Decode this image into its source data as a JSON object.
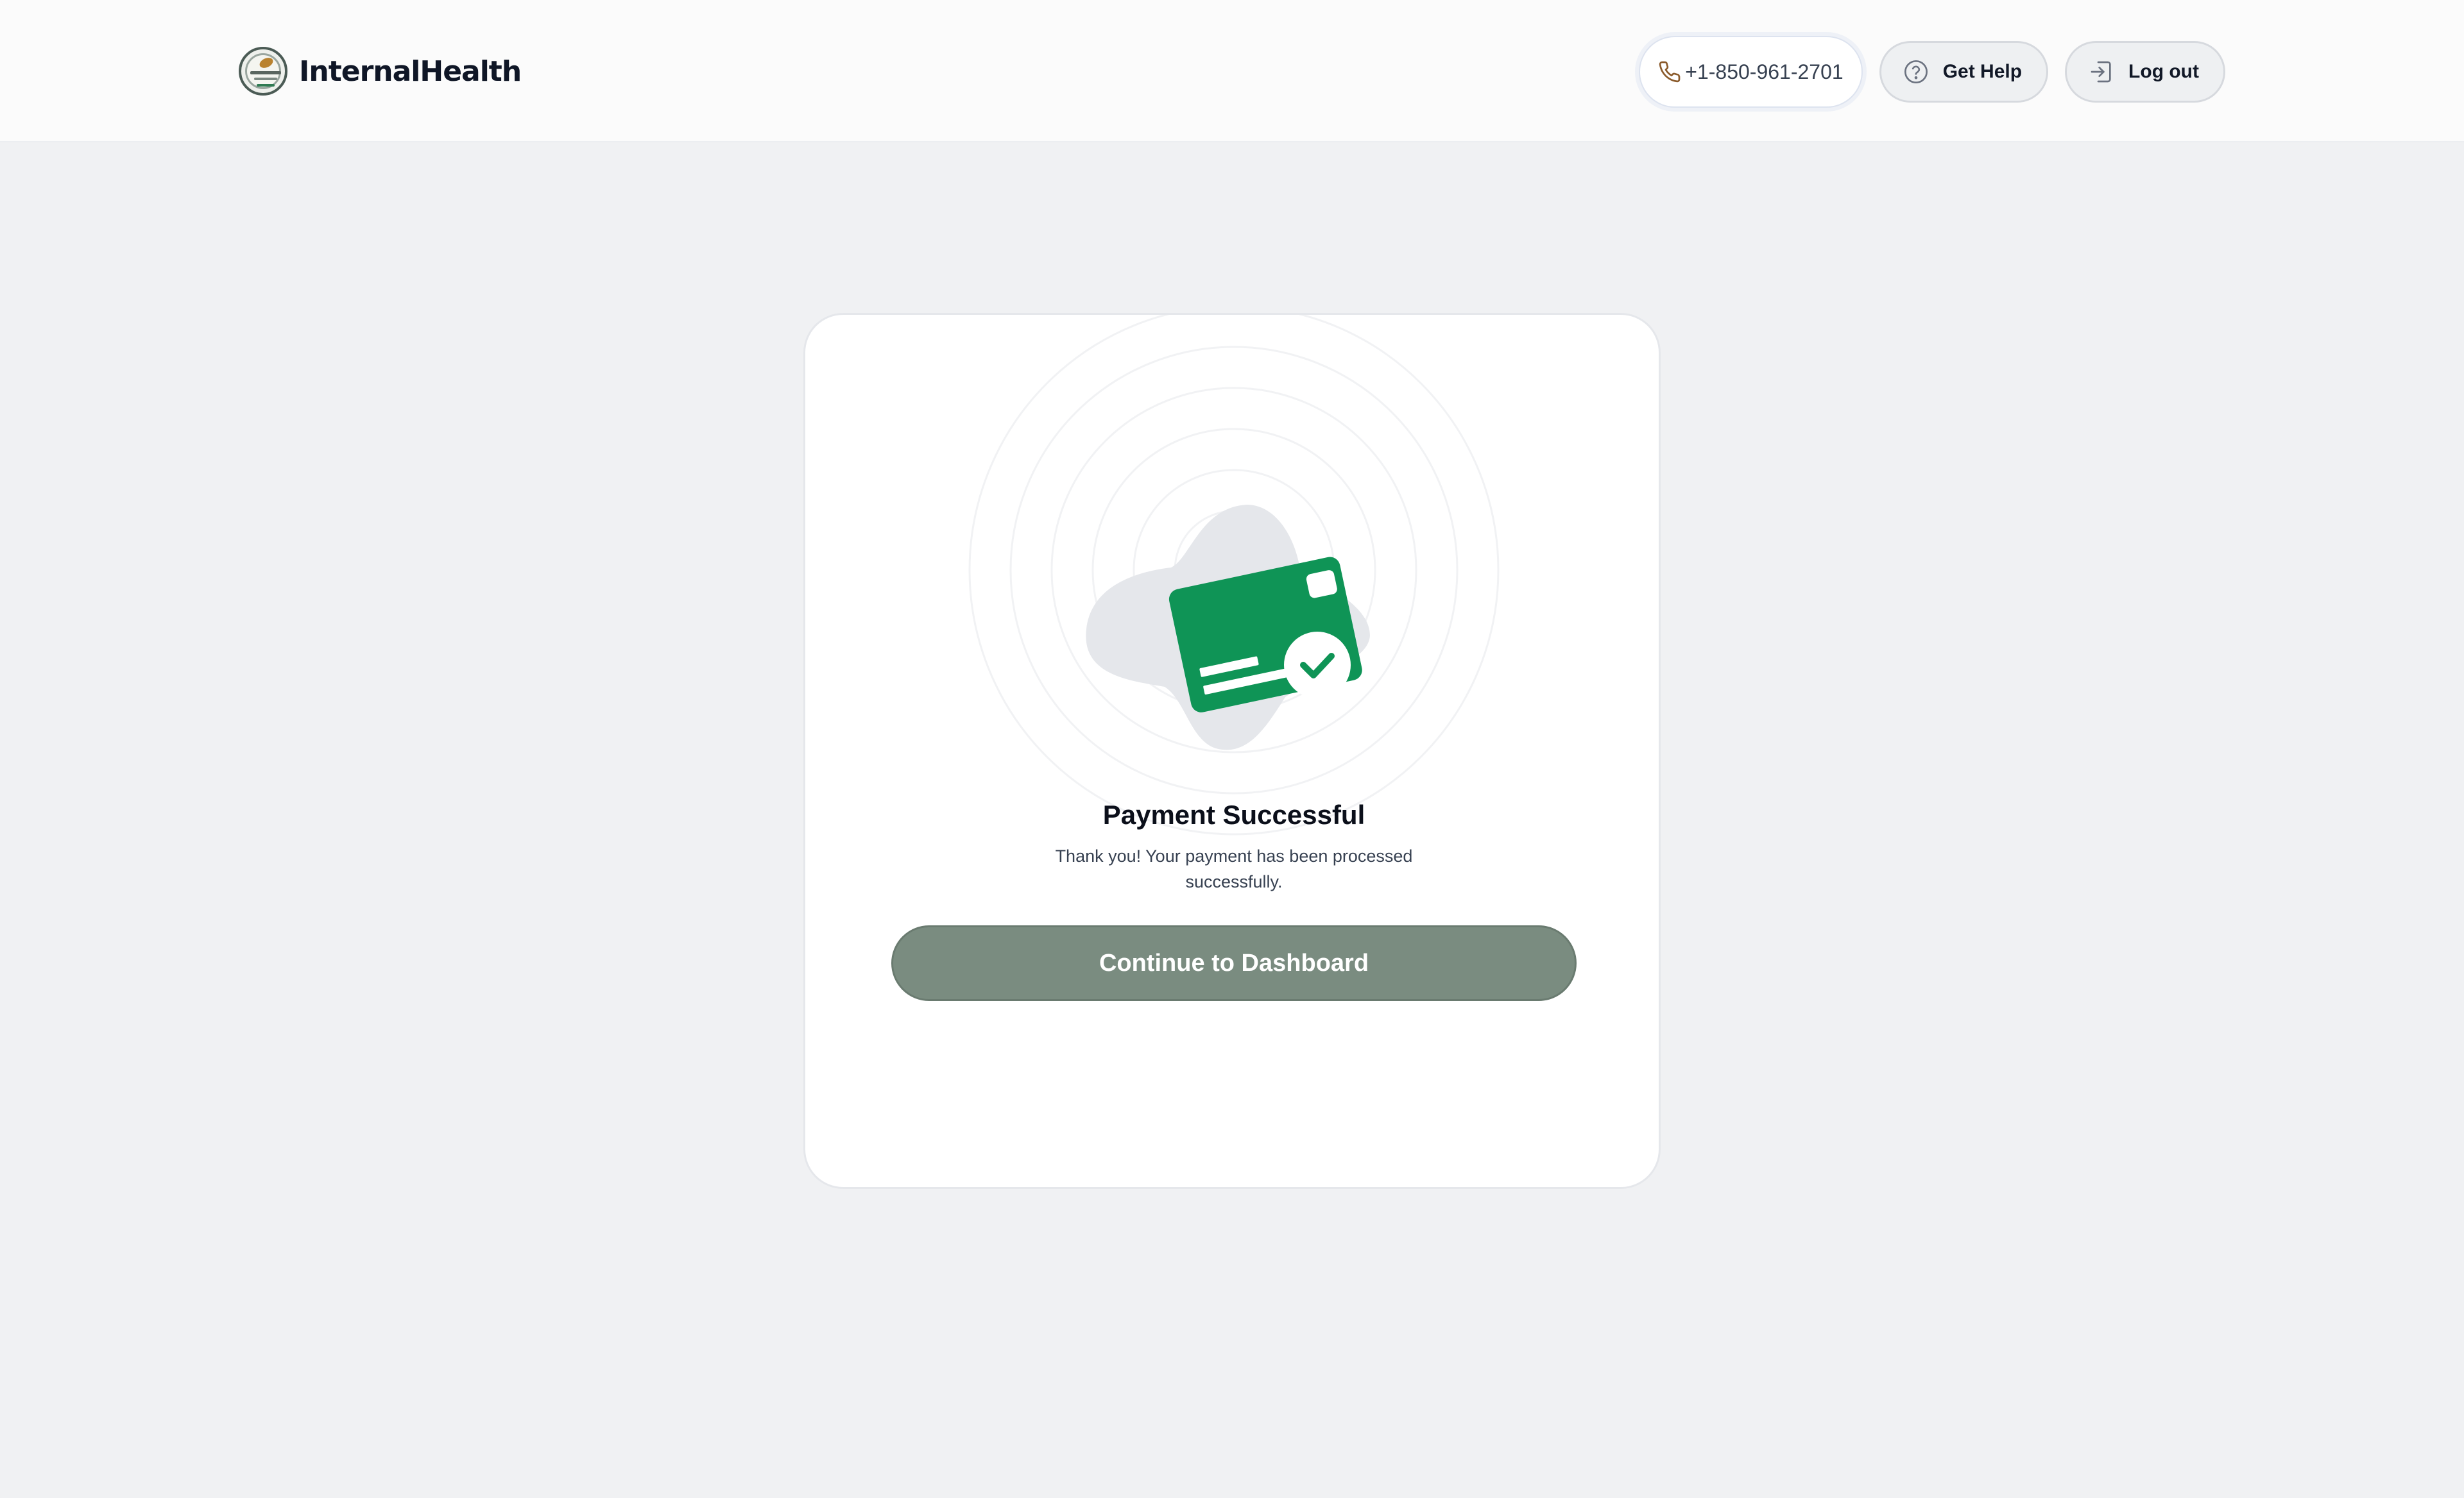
{
  "header": {
    "brand_name": "InternalHealth",
    "phone": "+1-850-961-2701",
    "help_label": "Get Help",
    "logout_label": "Log out"
  },
  "card": {
    "title": "Payment Successful",
    "message": "Thank you! Your payment has been processed successfully.",
    "cta_label": "Continue to Dashboard"
  },
  "icons": {
    "brand_logo": "internalhealth-logo",
    "phone": "phone-icon",
    "help": "question-circle-icon",
    "logout": "login-arrow-icon",
    "illustration": "credit-card-check-icon"
  },
  "colors": {
    "background": "#f0f1f3",
    "header_bg": "#fbfbfb",
    "card_bg": "#ffffff",
    "card_green": "#0f9456",
    "cta_bg": "#7a8c80",
    "blob": "#e5e7eb"
  }
}
